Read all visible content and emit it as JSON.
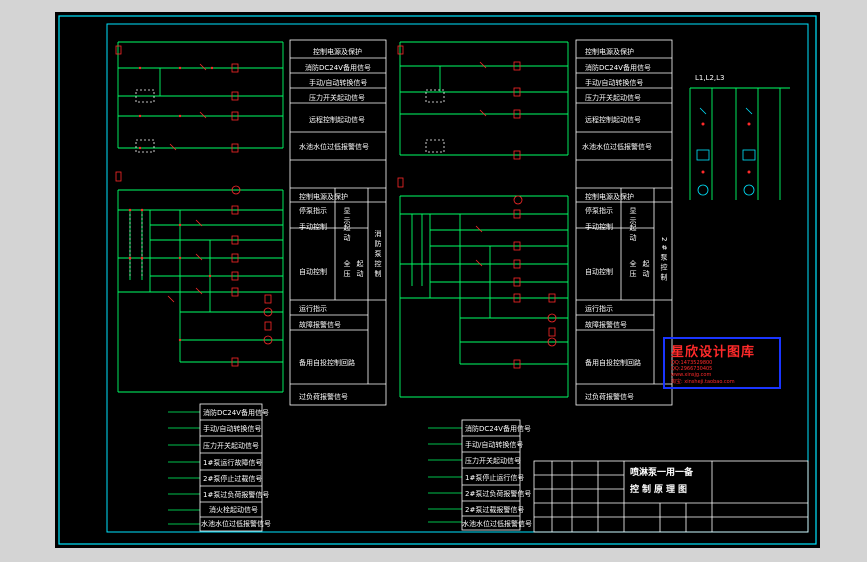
{
  "colors": {
    "background": "#000000",
    "frame": "#00e5ff",
    "wire": "#00ff66",
    "text": "#ffffff",
    "component": "#ff2a2a",
    "watermark_border": "#1a35ff",
    "page": "#d4d4d4"
  },
  "left_panel_labels": {
    "row1": "控制电源及保护",
    "row2": "消防DC24V备用信号",
    "row3": "手动/自动转换信号",
    "row4": "压力开关起动信号",
    "row5": "远程控制起动信号",
    "row6": "水池水位过低报警信号",
    "row7": "控制电源及保护",
    "row8": "停泵指示",
    "manual": "手动控制",
    "auto": "自动控制",
    "run_ind": "运行指示",
    "fault": "故障报警信号",
    "backup": "备用自投控制回路",
    "overload": "过负荷报警信号",
    "disp1": "显示",
    "disp2": "起动",
    "all": "全压",
    "start": "起动",
    "pump_ctrl_v": "消防泵控制"
  },
  "mid_panel_labels": {
    "row1": "控制电源及保护",
    "row2": "消防DC24V备用信号",
    "row3": "手动/自动转换信号",
    "row4": "压力开关起动信号",
    "row5": "远程控制起动信号",
    "row6": "水池水位过低报警信号",
    "row7": "控制电源及保护",
    "row8": "停泵指示",
    "manual": "手动控制",
    "auto": "自动控制",
    "run_ind": "运行指示",
    "fault": "故障报警信号",
    "backup": "备用自投控制回路",
    "overload": "过负荷报警信号",
    "disp1": "显示",
    "disp2": "起动",
    "all": "全压",
    "start": "起动",
    "pump_ctrl_v": "2#泵控制"
  },
  "bottom_left_labels": [
    "消防DC24V备用信号",
    "手动/自动转换信号",
    "压力开关起动信号",
    "1#泵运行故障信号",
    "2#泵停止过载信号",
    "1#泵过负荷报警信号",
    "消火栓起动信号",
    "水池水位过低报警信号"
  ],
  "bottom_mid_labels": [
    "消防DC24V备用信号",
    "手动/自动转换信号",
    "压力开关起动信号",
    "1#泵停止运行信号",
    "2#泵过负荷报警信号",
    "2#泵过载报警信号",
    "水池水位过低报警信号"
  ],
  "main_circuit_label": "L1,L2,L3",
  "title_block": {
    "line1": "喷淋泵一用一备",
    "line2": "控制原理图"
  },
  "watermark": {
    "title": "星欣设计图库",
    "line1": "QQ:1473529800",
    "line2": "QQ:2966730405",
    "line3": "www.xinsjg.com",
    "line4": "淘宝: xinsheji.taobao.com"
  }
}
